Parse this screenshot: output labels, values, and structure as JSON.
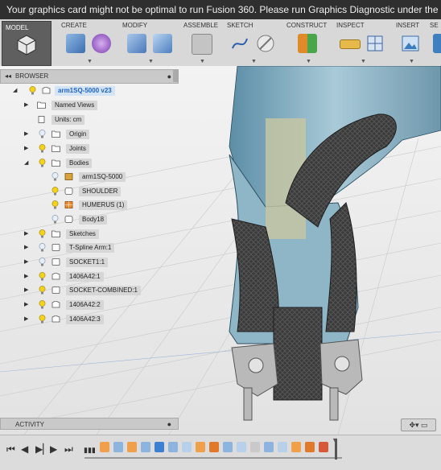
{
  "warning": {
    "text": "Your graphics card might not be optimal to run Fusion 360. Please run Graphics Diagnostic under the help menu to get more in"
  },
  "toolbar": {
    "workspace": "MODEL",
    "groups": [
      {
        "label": "CREATE"
      },
      {
        "label": "MODIFY"
      },
      {
        "label": "ASSEMBLE"
      },
      {
        "label": "SKETCH"
      },
      {
        "label": "CONSTRUCT"
      },
      {
        "label": "INSPECT"
      },
      {
        "label": "INSERT"
      },
      {
        "label": "SE"
      }
    ]
  },
  "browser": {
    "title": "BROWSER",
    "root": "arm1SQ-5000 v23",
    "items": [
      {
        "label": "Named Views"
      },
      {
        "label": "Units: cm"
      },
      {
        "label": "Origin"
      },
      {
        "label": "Joints"
      },
      {
        "label": "Bodies"
      },
      {
        "label": "arm1SQ-5000"
      },
      {
        "label": "SHOULDER"
      },
      {
        "label": "HUMERUS (1)"
      },
      {
        "label": "Body18"
      },
      {
        "label": "Sketches"
      },
      {
        "label": "T-Spline Arm:1"
      },
      {
        "label": "SOCKET1:1"
      },
      {
        "label": "1406A42:1"
      },
      {
        "label": "SOCKET-COMBINED:1"
      },
      {
        "label": "1406A42:2"
      },
      {
        "label": "1406A42:3"
      }
    ]
  },
  "activity": {
    "label": "ACTIVITY"
  },
  "colors": {
    "accent": "#1f63c5",
    "warning_bg": "#2f2f2f",
    "bulb": "#f2d21b"
  }
}
